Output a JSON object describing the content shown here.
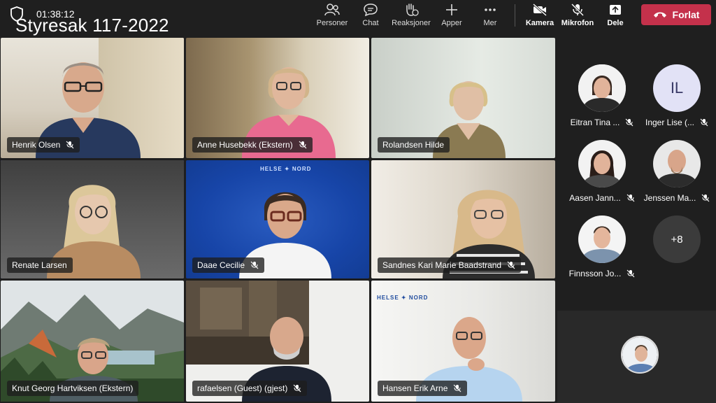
{
  "meeting": {
    "title": "Styresak 117-2022",
    "elapsed": "01:38:12"
  },
  "toolbar": {
    "people_label": "Personer",
    "chat_label": "Chat",
    "reactions_label": "Reaksjoner",
    "apps_label": "Apper",
    "more_label": "Mer",
    "camera_label": "Kamera",
    "mic_label": "Mikrofon",
    "share_label": "Dele",
    "leave_label": "Forlat"
  },
  "tiles": [
    {
      "name": "Henrik Olsen"
    },
    {
      "name": "Anne Husebekk (Ekstern)"
    },
    {
      "name": "Rolandsen Hilde"
    },
    {
      "name": "Renate Larsen"
    },
    {
      "name": "Daae Cecilie"
    },
    {
      "name": "Sandnes Kari Marie Baadstrand"
    },
    {
      "name": "Knut Georg Hartviksen (Ekstern)"
    },
    {
      "name": "rafaelsen (Guest) (gjest)"
    },
    {
      "name": "Hansen Erik Arne"
    }
  ],
  "logos": {
    "helse_nord_left": "HELSE",
    "helse_nord_right": "NORD"
  },
  "sidebar": {
    "participants": [
      {
        "label": "Eitran Tina ..."
      },
      {
        "label": "Inger Lise (...",
        "initials": "IL"
      },
      {
        "label": "Aasen Jann..."
      },
      {
        "label": "Jenssen Ma..."
      },
      {
        "label": "Finnsson Jo..."
      }
    ],
    "overflow": "+8"
  },
  "colors": {
    "leave": "#c4314b",
    "active_speaker": "#7f85f5",
    "background": "#1f1f1f"
  }
}
